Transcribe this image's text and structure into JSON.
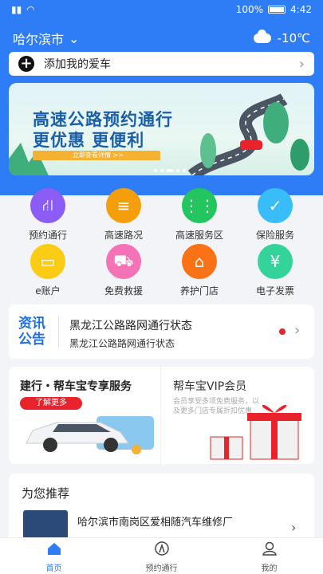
{
  "status_bar": {
    "battery": "100%",
    "time": "4:42"
  },
  "header": {
    "city": "哈尔滨市",
    "temperature": "-10℃",
    "weather_icon": "cloud-icon"
  },
  "add_car": {
    "label": "添加我的爱车"
  },
  "banner": {
    "line1": "高速公路预约通行",
    "line2": "更优惠 更便利",
    "cta": "立即查看详情 >>",
    "slide_count": 5,
    "active_slide": 3
  },
  "services": [
    {
      "label": "预约通行",
      "icon": "road-icon",
      "color": "#8b5cf6"
    },
    {
      "label": "高速路况",
      "icon": "traffic-light-icon",
      "color": "#f59e0b"
    },
    {
      "label": "高速服务区",
      "icon": "utensils-icon",
      "color": "#22c55e"
    },
    {
      "label": "保险服务",
      "icon": "shield-check-icon",
      "color": "#38bdf8"
    },
    {
      "label": "e账户",
      "icon": "wallet-icon",
      "color": "#facc15"
    },
    {
      "label": "免费救援",
      "icon": "tow-car-icon",
      "color": "#f472b6"
    },
    {
      "label": "养护门店",
      "icon": "store-icon",
      "color": "#f97316"
    },
    {
      "label": "电子发票",
      "icon": "invoice-icon",
      "color": "#34d399"
    }
  ],
  "notice": {
    "logo_line1": "资讯",
    "logo_line2": "公告",
    "title": "黑龙江公路路网通行状态",
    "subtitle": "黑龙江公路路网通行状态"
  },
  "promo": {
    "left_title": "建行・帮车宝专享服务",
    "left_badge": "了解更多",
    "right_title": "帮车宝VIP会员",
    "right_sub": "会员享受多项免费服务，以及更多门店专属折扣优惠"
  },
  "recommend": {
    "title": "为您推荐",
    "shop_name": "哈尔滨市南岗区爱相随汽车维修厂"
  },
  "tabbar": [
    {
      "label": "首页",
      "icon": "home-icon",
      "active": true
    },
    {
      "label": "预约通行",
      "icon": "reservation-icon",
      "active": false
    },
    {
      "label": "我的",
      "icon": "profile-icon",
      "active": false
    }
  ]
}
